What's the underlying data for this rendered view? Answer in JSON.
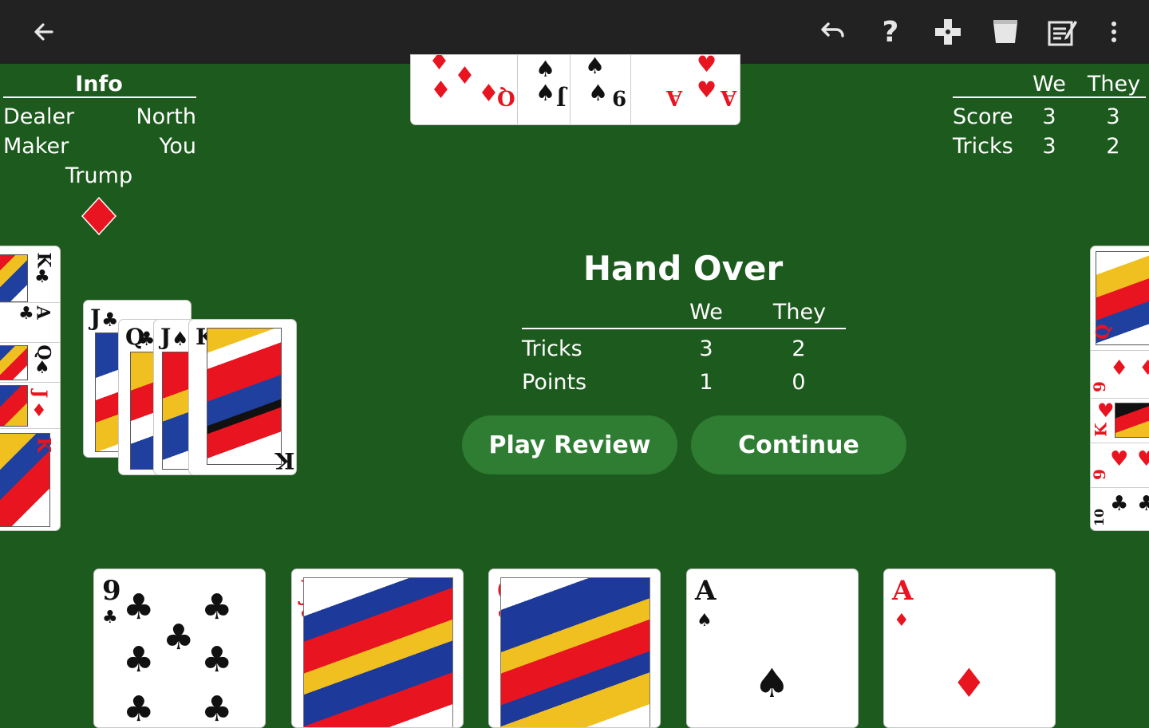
{
  "toolbar": {
    "icons": [
      "back-arrow-icon",
      "undo-icon",
      "help-icon",
      "dpad-icon",
      "trash-icon",
      "scorecard-icon",
      "more-vert-icon"
    ]
  },
  "info": {
    "title": "Info",
    "dealer_label": "Dealer",
    "dealer_value": "North",
    "maker_label": "Maker",
    "maker_value": "You",
    "trump_label": "Trump",
    "trump_suit": "♦"
  },
  "scoreboard": {
    "we": "We",
    "they": "They",
    "score_label": "Score",
    "score_we": "3",
    "score_they": "3",
    "tricks_label": "Tricks",
    "tricks_we": "3",
    "tricks_they": "2"
  },
  "hand_over": {
    "title": "Hand Over",
    "we": "We",
    "they": "They",
    "tricks_label": "Tricks",
    "tricks_we": "3",
    "tricks_they": "2",
    "points_label": "Points",
    "points_we": "1",
    "points_they": "0",
    "play_review_label": "Play Review",
    "continue_label": "Continue"
  },
  "cards": {
    "north": [
      {
        "rank": "Q",
        "suit": "♦"
      },
      {
        "rank": "J",
        "suit": "♠"
      },
      {
        "rank": "9",
        "suit": "♠"
      },
      {
        "rank": "A",
        "suit": "♥"
      }
    ],
    "west_column": [
      {
        "rank": "K",
        "suit": "♣"
      },
      {
        "rank": "A",
        "suit": "♣"
      },
      {
        "rank": "Q",
        "suit": "♠"
      },
      {
        "rank": "J",
        "suit": "♦"
      },
      {
        "rank": "K",
        "suit": "♦"
      }
    ],
    "trick": [
      {
        "rank": "J",
        "suit": "♣"
      },
      {
        "rank": "Q",
        "suit": "♣"
      },
      {
        "rank": "J",
        "suit": "♠"
      },
      {
        "rank": "K",
        "suit": "♠"
      }
    ],
    "east_column": [
      {
        "rank": "Q",
        "suit": "♦"
      },
      {
        "rank": "9",
        "suit": "♦"
      },
      {
        "rank": "K",
        "suit": "♥"
      },
      {
        "rank": "9",
        "suit": "♥"
      },
      {
        "rank": "10",
        "suit": "♣"
      }
    ],
    "hand": [
      {
        "rank": "9",
        "suit": "♣"
      },
      {
        "rank": "J",
        "suit": "♥"
      },
      {
        "rank": "Q",
        "suit": "♥"
      },
      {
        "rank": "A",
        "suit": "♠"
      },
      {
        "rank": "A",
        "suit": "♦"
      }
    ]
  }
}
